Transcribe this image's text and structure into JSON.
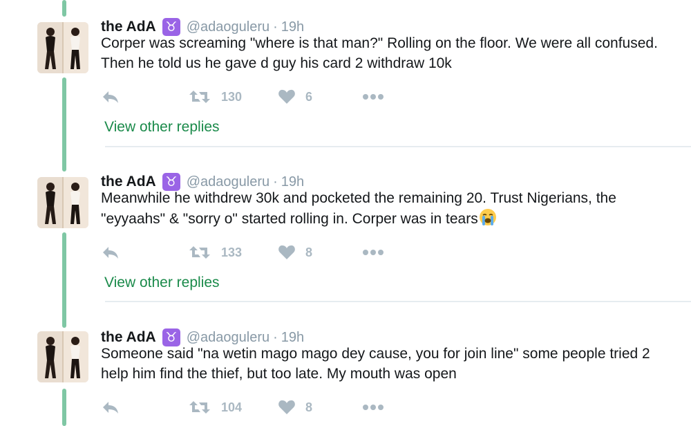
{
  "tweets": [
    {
      "name": "the AdA",
      "badge": "♉",
      "handle": "@adaoguleru",
      "separator": "·",
      "time": "19h",
      "text": "Corper was screaming \"where is that man?\" Rolling on the floor. We were all confused. Then he told us he gave d guy his card 2 withdraw 10k",
      "retweets": "130",
      "likes": "6",
      "view_replies": "View other replies"
    },
    {
      "name": "the AdA",
      "badge": "♉",
      "handle": "@adaoguleru",
      "separator": "·",
      "time": "19h",
      "text": "Meanwhile he withdrew 30k and pocketed the remaining 20. Trust Nigerians, the \"eyyaahs\" & \"sorry o\" started rolling in. Corper was in tears",
      "emoji": "loudly-crying-face",
      "retweets": "133",
      "likes": "8",
      "view_replies": "View other replies"
    },
    {
      "name": "the AdA",
      "badge": "♉",
      "handle": "@adaoguleru",
      "separator": "·",
      "time": "19h",
      "text": "Someone said \"na wetin mago mago dey cause, you for join line\" some people tried 2 help him find the thief, but too late. My mouth was open",
      "retweets": "104",
      "likes": "8"
    }
  ],
  "colors": {
    "thread_line": "#7fc7a4",
    "link_green": "#1a8a4a",
    "muted": "#8899a6",
    "action_gray": "#aab8c2",
    "badge_purple": "#9a64e6"
  }
}
